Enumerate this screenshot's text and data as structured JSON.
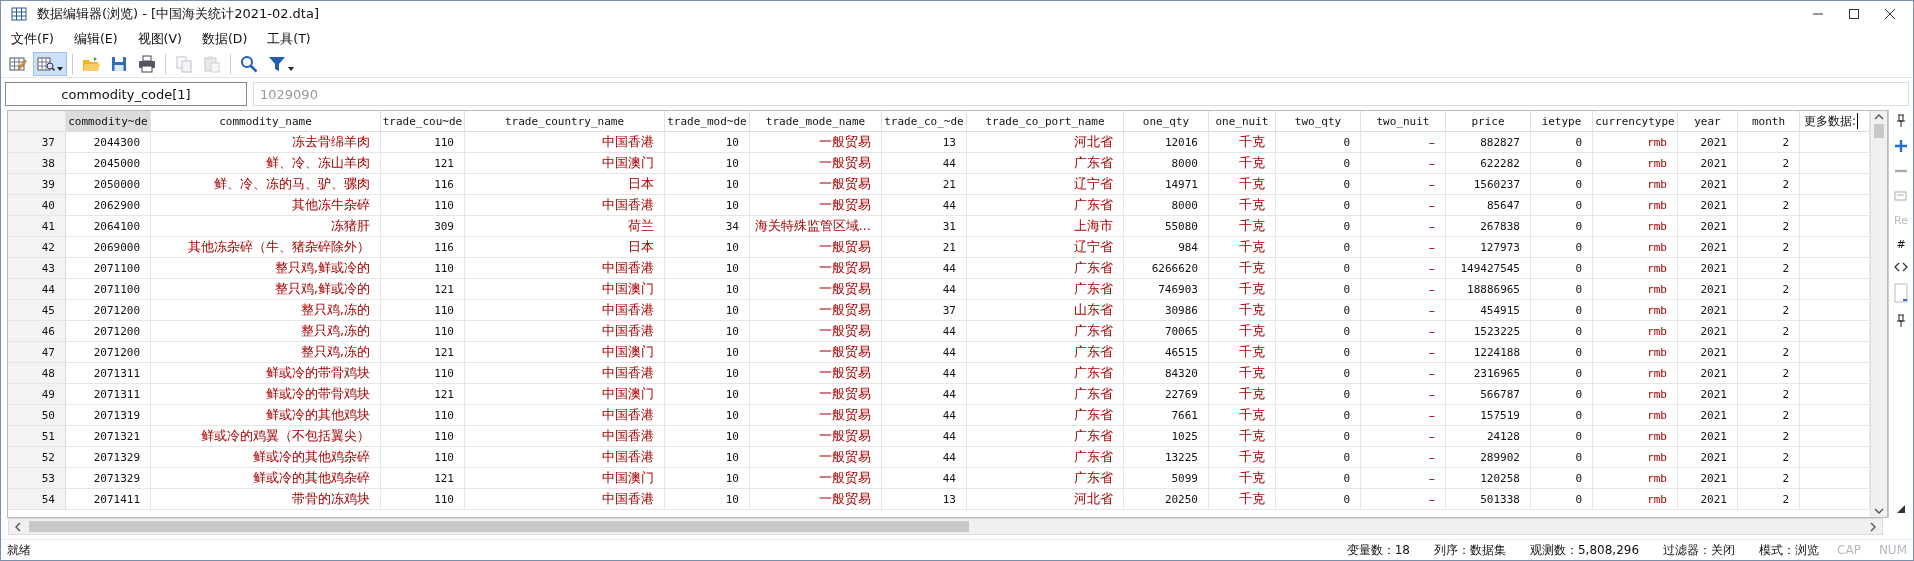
{
  "window": {
    "title": "数据编辑器(浏览) - [中国海关统计2021-02.dta]"
  },
  "menu": [
    "文件(F)",
    "编辑(E)",
    "视图(V)",
    "数据(D)",
    "工具(T)"
  ],
  "toolbar": [
    {
      "kind": "edit",
      "selected": false,
      "disabled": false,
      "dropdown": false
    },
    {
      "kind": "browse",
      "selected": true,
      "disabled": false,
      "dropdown": true
    },
    {
      "kind": "open",
      "selected": false,
      "disabled": false,
      "dropdown": false
    },
    {
      "kind": "save",
      "selected": false,
      "disabled": false,
      "dropdown": false
    },
    {
      "kind": "print",
      "selected": false,
      "disabled": false,
      "dropdown": false
    },
    {
      "kind": "copy",
      "selected": false,
      "disabled": true,
      "dropdown": false
    },
    {
      "kind": "paste",
      "selected": false,
      "disabled": true,
      "dropdown": false
    },
    {
      "kind": "search",
      "selected": false,
      "disabled": false,
      "dropdown": false
    },
    {
      "kind": "filter",
      "selected": false,
      "disabled": false,
      "dropdown": true
    }
  ],
  "variable_bar": {
    "name": "commodity_code[1]",
    "value": "1029090"
  },
  "table": {
    "columns": [
      {
        "name": "commodity~de",
        "kind": "numeric",
        "selected": true
      },
      {
        "name": "commodity_name",
        "kind": "string",
        "selected": false
      },
      {
        "name": "trade_cou~de",
        "kind": "numeric",
        "selected": false
      },
      {
        "name": "trade_country_name",
        "kind": "string",
        "selected": false
      },
      {
        "name": "trade_mod~de",
        "kind": "numeric",
        "selected": false
      },
      {
        "name": "trade_mode_name",
        "kind": "string",
        "selected": false
      },
      {
        "name": "trade_co_~de",
        "kind": "numeric",
        "selected": false
      },
      {
        "name": "trade_co_port_name",
        "kind": "string",
        "selected": false
      },
      {
        "name": "one_qty",
        "kind": "numeric",
        "selected": false
      },
      {
        "name": "one_nuit",
        "kind": "string",
        "selected": false
      },
      {
        "name": "two_qty",
        "kind": "numeric",
        "selected": false
      },
      {
        "name": "two_nuit",
        "kind": "string",
        "selected": false
      },
      {
        "name": "price",
        "kind": "numeric",
        "selected": false
      },
      {
        "name": "ietype",
        "kind": "numeric",
        "selected": false
      },
      {
        "name": "currencytype",
        "kind": "code",
        "selected": false
      },
      {
        "name": "year",
        "kind": "numeric",
        "selected": false
      },
      {
        "name": "month",
        "kind": "numeric",
        "selected": false
      }
    ],
    "more_header": "更多数据:",
    "rows": [
      {
        "number": "37",
        "cells": [
          "2044300",
          "冻去骨绵羊肉",
          "110",
          "中国香港",
          "10",
          "一般贸易",
          "13",
          "河北省",
          "12016",
          "千克",
          "0",
          "–",
          "882827",
          "0",
          "rmb",
          "2021",
          "2"
        ]
      },
      {
        "number": "38",
        "cells": [
          "2045000",
          "鲜、冷、冻山羊肉",
          "121",
          "中国澳门",
          "10",
          "一般贸易",
          "44",
          "广东省",
          "8000",
          "千克",
          "0",
          "–",
          "622282",
          "0",
          "rmb",
          "2021",
          "2"
        ]
      },
      {
        "number": "39",
        "cells": [
          "2050000",
          "鲜、冷、冻的马、驴、骡肉",
          "116",
          "日本",
          "10",
          "一般贸易",
          "21",
          "辽宁省",
          "14971",
          "千克",
          "0",
          "–",
          "1560237",
          "0",
          "rmb",
          "2021",
          "2"
        ]
      },
      {
        "number": "40",
        "cells": [
          "2062900",
          "其他冻牛杂碎",
          "110",
          "中国香港",
          "10",
          "一般贸易",
          "44",
          "广东省",
          "8000",
          "千克",
          "0",
          "–",
          "85647",
          "0",
          "rmb",
          "2021",
          "2"
        ]
      },
      {
        "number": "41",
        "cells": [
          "2064100",
          "冻猪肝",
          "309",
          "荷兰",
          "34",
          "海关特殊监管区域…",
          "31",
          "上海市",
          "55080",
          "千克",
          "0",
          "–",
          "267838",
          "0",
          "rmb",
          "2021",
          "2"
        ]
      },
      {
        "number": "42",
        "cells": [
          "2069000",
          "其他冻杂碎（牛、猪杂碎除外）",
          "116",
          "日本",
          "10",
          "一般贸易",
          "21",
          "辽宁省",
          "984",
          "千克",
          "0",
          "–",
          "127973",
          "0",
          "rmb",
          "2021",
          "2"
        ]
      },
      {
        "number": "43",
        "cells": [
          "2071100",
          "整只鸡,鲜或冷的",
          "110",
          "中国香港",
          "10",
          "一般贸易",
          "44",
          "广东省",
          "6266620",
          "千克",
          "0",
          "–",
          "149427545",
          "0",
          "rmb",
          "2021",
          "2"
        ]
      },
      {
        "number": "44",
        "cells": [
          "2071100",
          "整只鸡,鲜或冷的",
          "121",
          "中国澳门",
          "10",
          "一般贸易",
          "44",
          "广东省",
          "746903",
          "千克",
          "0",
          "–",
          "18886965",
          "0",
          "rmb",
          "2021",
          "2"
        ]
      },
      {
        "number": "45",
        "cells": [
          "2071200",
          "整只鸡,冻的",
          "110",
          "中国香港",
          "10",
          "一般贸易",
          "37",
          "山东省",
          "30986",
          "千克",
          "0",
          "–",
          "454915",
          "0",
          "rmb",
          "2021",
          "2"
        ]
      },
      {
        "number": "46",
        "cells": [
          "2071200",
          "整只鸡,冻的",
          "110",
          "中国香港",
          "10",
          "一般贸易",
          "44",
          "广东省",
          "70065",
          "千克",
          "0",
          "–",
          "1523225",
          "0",
          "rmb",
          "2021",
          "2"
        ]
      },
      {
        "number": "47",
        "cells": [
          "2071200",
          "整只鸡,冻的",
          "121",
          "中国澳门",
          "10",
          "一般贸易",
          "44",
          "广东省",
          "46515",
          "千克",
          "0",
          "–",
          "1224188",
          "0",
          "rmb",
          "2021",
          "2"
        ]
      },
      {
        "number": "48",
        "cells": [
          "2071311",
          "鲜或冷的带骨鸡块",
          "110",
          "中国香港",
          "10",
          "一般贸易",
          "44",
          "广东省",
          "84320",
          "千克",
          "0",
          "–",
          "2316965",
          "0",
          "rmb",
          "2021",
          "2"
        ]
      },
      {
        "number": "49",
        "cells": [
          "2071311",
          "鲜或冷的带骨鸡块",
          "121",
          "中国澳门",
          "10",
          "一般贸易",
          "44",
          "广东省",
          "22769",
          "千克",
          "0",
          "–",
          "566787",
          "0",
          "rmb",
          "2021",
          "2"
        ]
      },
      {
        "number": "50",
        "cells": [
          "2071319",
          "鲜或冷的其他鸡块",
          "110",
          "中国香港",
          "10",
          "一般贸易",
          "44",
          "广东省",
          "7661",
          "千克",
          "0",
          "–",
          "157519",
          "0",
          "rmb",
          "2021",
          "2"
        ]
      },
      {
        "number": "51",
        "cells": [
          "2071321",
          "鲜或冷的鸡翼（不包括翼尖）",
          "110",
          "中国香港",
          "10",
          "一般贸易",
          "44",
          "广东省",
          "1025",
          "千克",
          "0",
          "–",
          "24128",
          "0",
          "rmb",
          "2021",
          "2"
        ]
      },
      {
        "number": "52",
        "cells": [
          "2071329",
          "鲜或冷的其他鸡杂碎",
          "110",
          "中国香港",
          "10",
          "一般贸易",
          "44",
          "广东省",
          "13225",
          "千克",
          "0",
          "–",
          "289902",
          "0",
          "rmb",
          "2021",
          "2"
        ]
      },
      {
        "number": "53",
        "cells": [
          "2071329",
          "鲜或冷的其他鸡杂碎",
          "121",
          "中国澳门",
          "10",
          "一般贸易",
          "44",
          "广东省",
          "5099",
          "千克",
          "0",
          "–",
          "120258",
          "0",
          "rmb",
          "2021",
          "2"
        ]
      },
      {
        "number": "54",
        "cells": [
          "2071411",
          "带骨的冻鸡块",
          "110",
          "中国香港",
          "10",
          "一般贸易",
          "13",
          "河北省",
          "20250",
          "千克",
          "0",
          "–",
          "501338",
          "0",
          "rmb",
          "2021",
          "2"
        ]
      }
    ]
  },
  "side_panel": {
    "labels": [
      "Re",
      "#"
    ]
  },
  "status_bar": {
    "text": "就绪",
    "items": [
      "变量数：18",
      "列序：数据集",
      "观测数：5,808,296",
      "过滤器：关闭",
      "模式：浏览"
    ],
    "indicators": [
      {
        "label": "CAP",
        "on": false
      },
      {
        "label": "NUM",
        "on": false
      }
    ]
  }
}
